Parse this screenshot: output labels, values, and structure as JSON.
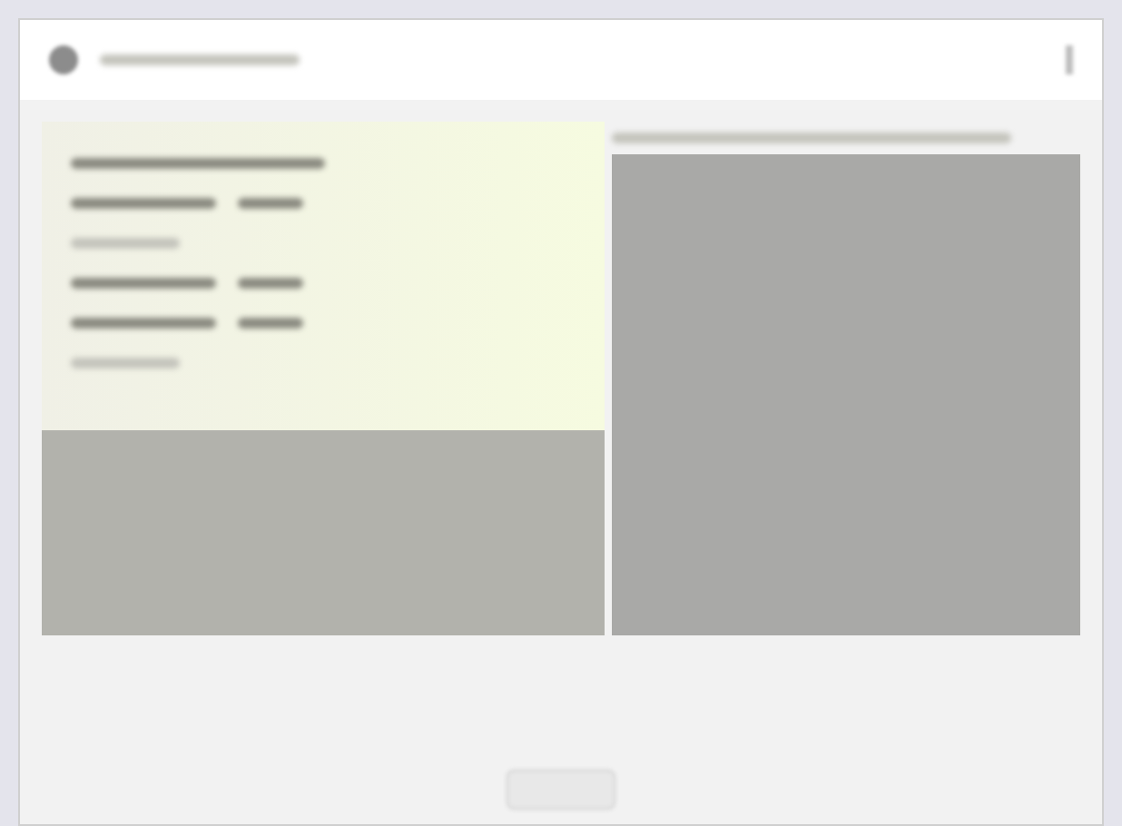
{
  "window": {
    "has_icon": true,
    "has_close": true
  },
  "info_panel": {
    "rows": [
      {
        "kind": "heading"
      },
      {
        "kind": "pair"
      },
      {
        "kind": "single"
      },
      {
        "kind": "pair"
      },
      {
        "kind": "pair"
      },
      {
        "kind": "single"
      }
    ]
  },
  "footer": {
    "has_button": true
  }
}
